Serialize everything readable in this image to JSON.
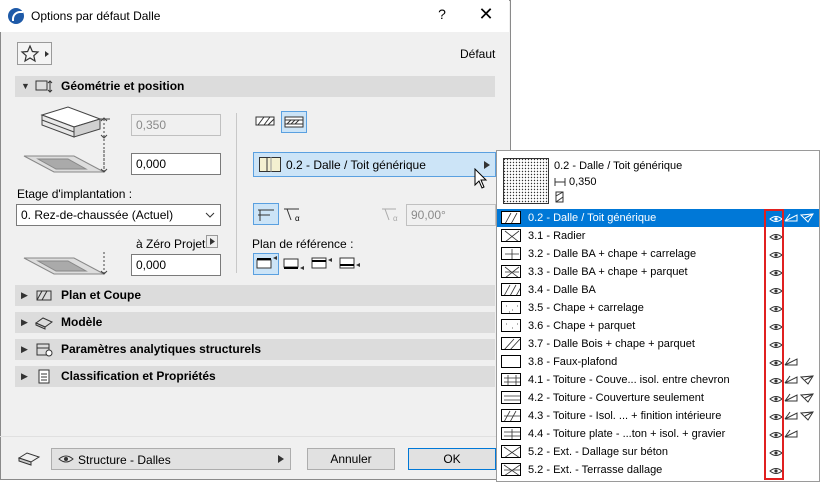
{
  "window": {
    "title": "Options par défaut Dalle",
    "help": "?",
    "close": "✕"
  },
  "header": {
    "default_label": "Défaut"
  },
  "geometry": {
    "section_title": "Géométrie et position",
    "thickness_value": "0,350",
    "offset_value": "0,000",
    "story_label": "Etage d'implantation :",
    "story_value": "0. Rez-de-chaussée (Actuel)",
    "project_zero_label": "à Zéro Projet",
    "project_zero_value": "0,000",
    "composite_value": "0.2 - Dalle / Toit générique",
    "angle_value": "90,00°",
    "ref_plane_label": "Plan de référence :"
  },
  "sections": [
    {
      "label": "Plan et Coupe"
    },
    {
      "label": "Modèle"
    },
    {
      "label": "Paramètres analytiques structurels"
    },
    {
      "label": "Classification et Propriétés"
    }
  ],
  "footer": {
    "layer_value": "Structure - Dalles",
    "cancel_label": "Annuler",
    "ok_label": "OK"
  },
  "popup": {
    "preview_name": "0.2 - Dalle / Toit générique",
    "preview_thickness": "0,350",
    "items": [
      {
        "label": "0.2 - Dalle / Toit générique",
        "selected": true
      },
      {
        "label": "3.1 - Radier"
      },
      {
        "label": "3.2 - Dalle BA + chape + carrelage"
      },
      {
        "label": "3.3 - Dalle BA + chape + parquet"
      },
      {
        "label": "3.4 - Dalle BA"
      },
      {
        "label": "3.5 - Chape + carrelage"
      },
      {
        "label": "3.6 - Chape + parquet"
      },
      {
        "label": "3.7 - Dalle Bois + chape + parquet"
      },
      {
        "label": "3.8 - Faux-plafond"
      },
      {
        "label": "4.1 - Toiture - Couve... isol. entre chevron"
      },
      {
        "label": "4.2 - Toiture - Couverture seulement"
      },
      {
        "label": "4.3 - Toiture - Isol. ... + finition intérieure"
      },
      {
        "label": "4.4 - Toiture plate - ...ton + isol. + gravier"
      },
      {
        "label": "5.2 - Ext. - Dallage sur béton"
      },
      {
        "label": "5.2 - Ext. - Terrasse dallage"
      }
    ]
  }
}
